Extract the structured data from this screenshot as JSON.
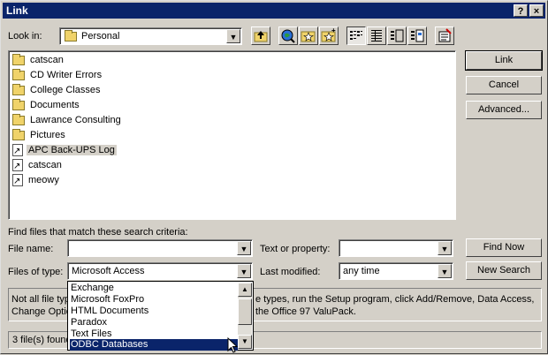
{
  "window": {
    "title": "Link",
    "help_label": "?",
    "close_label": "×"
  },
  "look_in": {
    "label": "Look in:",
    "value": "Personal",
    "arrow": "▼"
  },
  "toolbar": {
    "icons": [
      "up-one-level-icon",
      "search-web-icon",
      "look-in-favorites-icon",
      "add-to-favorites-icon",
      "list-view-icon",
      "details-view-icon",
      "properties-view-icon",
      "preview-view-icon",
      "commands-settings-icon"
    ]
  },
  "files": [
    {
      "name": "catscan",
      "type": "folder"
    },
    {
      "name": "CD Writer Errors",
      "type": "folder"
    },
    {
      "name": "College Classes",
      "type": "folder"
    },
    {
      "name": "Documents",
      "type": "folder"
    },
    {
      "name": "Lawrance Consulting",
      "type": "folder"
    },
    {
      "name": "Pictures",
      "type": "folder"
    },
    {
      "name": "APC Back-UPS Log",
      "type": "link"
    },
    {
      "name": "catscan",
      "type": "link"
    },
    {
      "name": "meowy",
      "type": "link"
    }
  ],
  "buttons": {
    "link": "Link",
    "cancel": "Cancel",
    "advanced": "Advanced...",
    "find_now": "Find Now",
    "new_search": "New Search"
  },
  "search": {
    "heading": "Find files that match these search criteria:",
    "file_name_label": "File name:",
    "file_name_value": "",
    "text_label": "Text or property:",
    "text_value": "",
    "type_label": "Files of type:",
    "type_value": "Microsoft Access",
    "modified_label": "Last modified:",
    "modified_value": "any time"
  },
  "info_text": {
    "line1_a": "Not all file typ",
    "line1_b": "e types, run the Setup program, click Add/Remove, Data Access,",
    "line2_a": "Change Optio",
    "line2_b": "the Office 97 ValuPack."
  },
  "status": {
    "text": "3 file(s) found"
  },
  "type_dropdown": {
    "options": [
      "Exchange",
      "Microsoft FoxPro",
      "HTML Documents",
      "Paradox",
      "Text Files",
      "ODBC Databases"
    ],
    "selected": "ODBC Databases"
  }
}
